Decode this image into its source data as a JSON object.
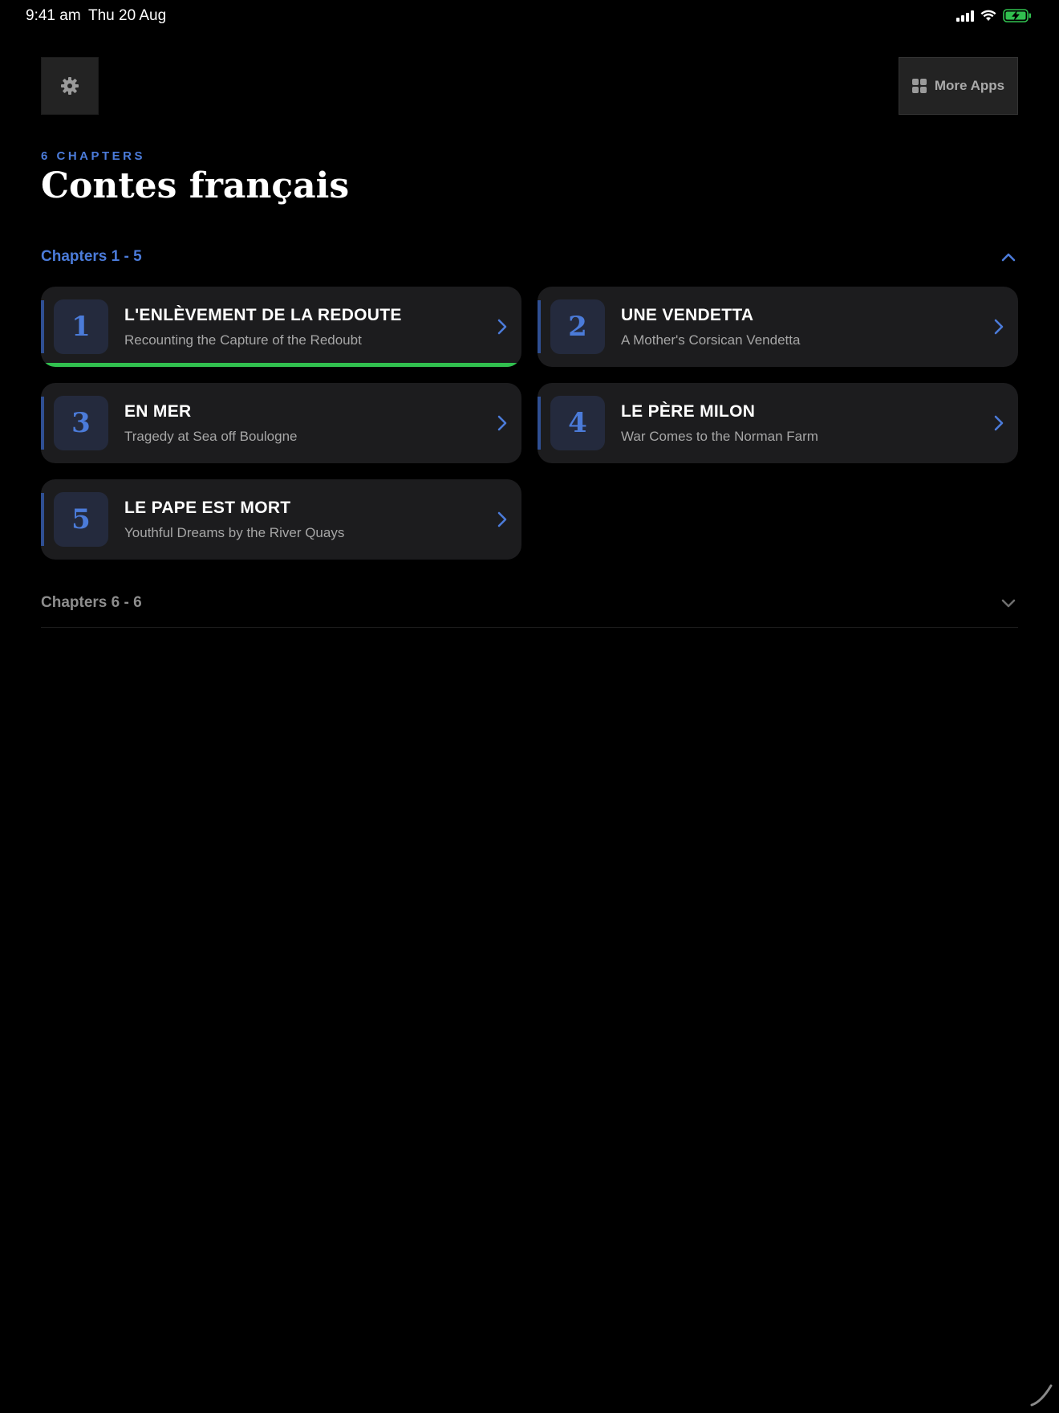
{
  "status_bar": {
    "time": "9:41 am",
    "date": "Thu 20 Aug"
  },
  "header": {
    "more_apps_label": "More Apps"
  },
  "book": {
    "chapter_count_label": "6 CHAPTERS",
    "title": "Contes français"
  },
  "sections": [
    {
      "label": "Chapters 1 - 5",
      "expanded": true,
      "chapters": [
        {
          "number": "1",
          "title": "L'ENLÈVEMENT DE LA REDOUTE",
          "subtitle": "Recounting the Capture of the Redoubt",
          "progress": 1.0
        },
        {
          "number": "2",
          "title": "UNE VENDETTA",
          "subtitle": "A Mother's Corsican Vendetta",
          "progress": 0
        },
        {
          "number": "3",
          "title": "EN MER",
          "subtitle": "Tragedy at Sea off Boulogne",
          "progress": 0
        },
        {
          "number": "4",
          "title": "LE PÈRE MILON",
          "subtitle": "War Comes to the Norman Farm",
          "progress": 0
        },
        {
          "number": "5",
          "title": "LE PAPE EST MORT",
          "subtitle": "Youthful Dreams by the River Quays",
          "progress": 0
        }
      ]
    },
    {
      "label": "Chapters 6 - 6",
      "expanded": false
    }
  ],
  "colors": {
    "accent": "#4b7bd9",
    "progress": "#31c04f",
    "card": "#1c1c1e",
    "battery": "#31c04f"
  },
  "icons": {
    "settings": "gear-icon",
    "more_apps": "grid-icon",
    "chapter_open": "chevron-right-icon",
    "collapse": "chevron-up-icon",
    "expand": "chevron-down-icon"
  }
}
